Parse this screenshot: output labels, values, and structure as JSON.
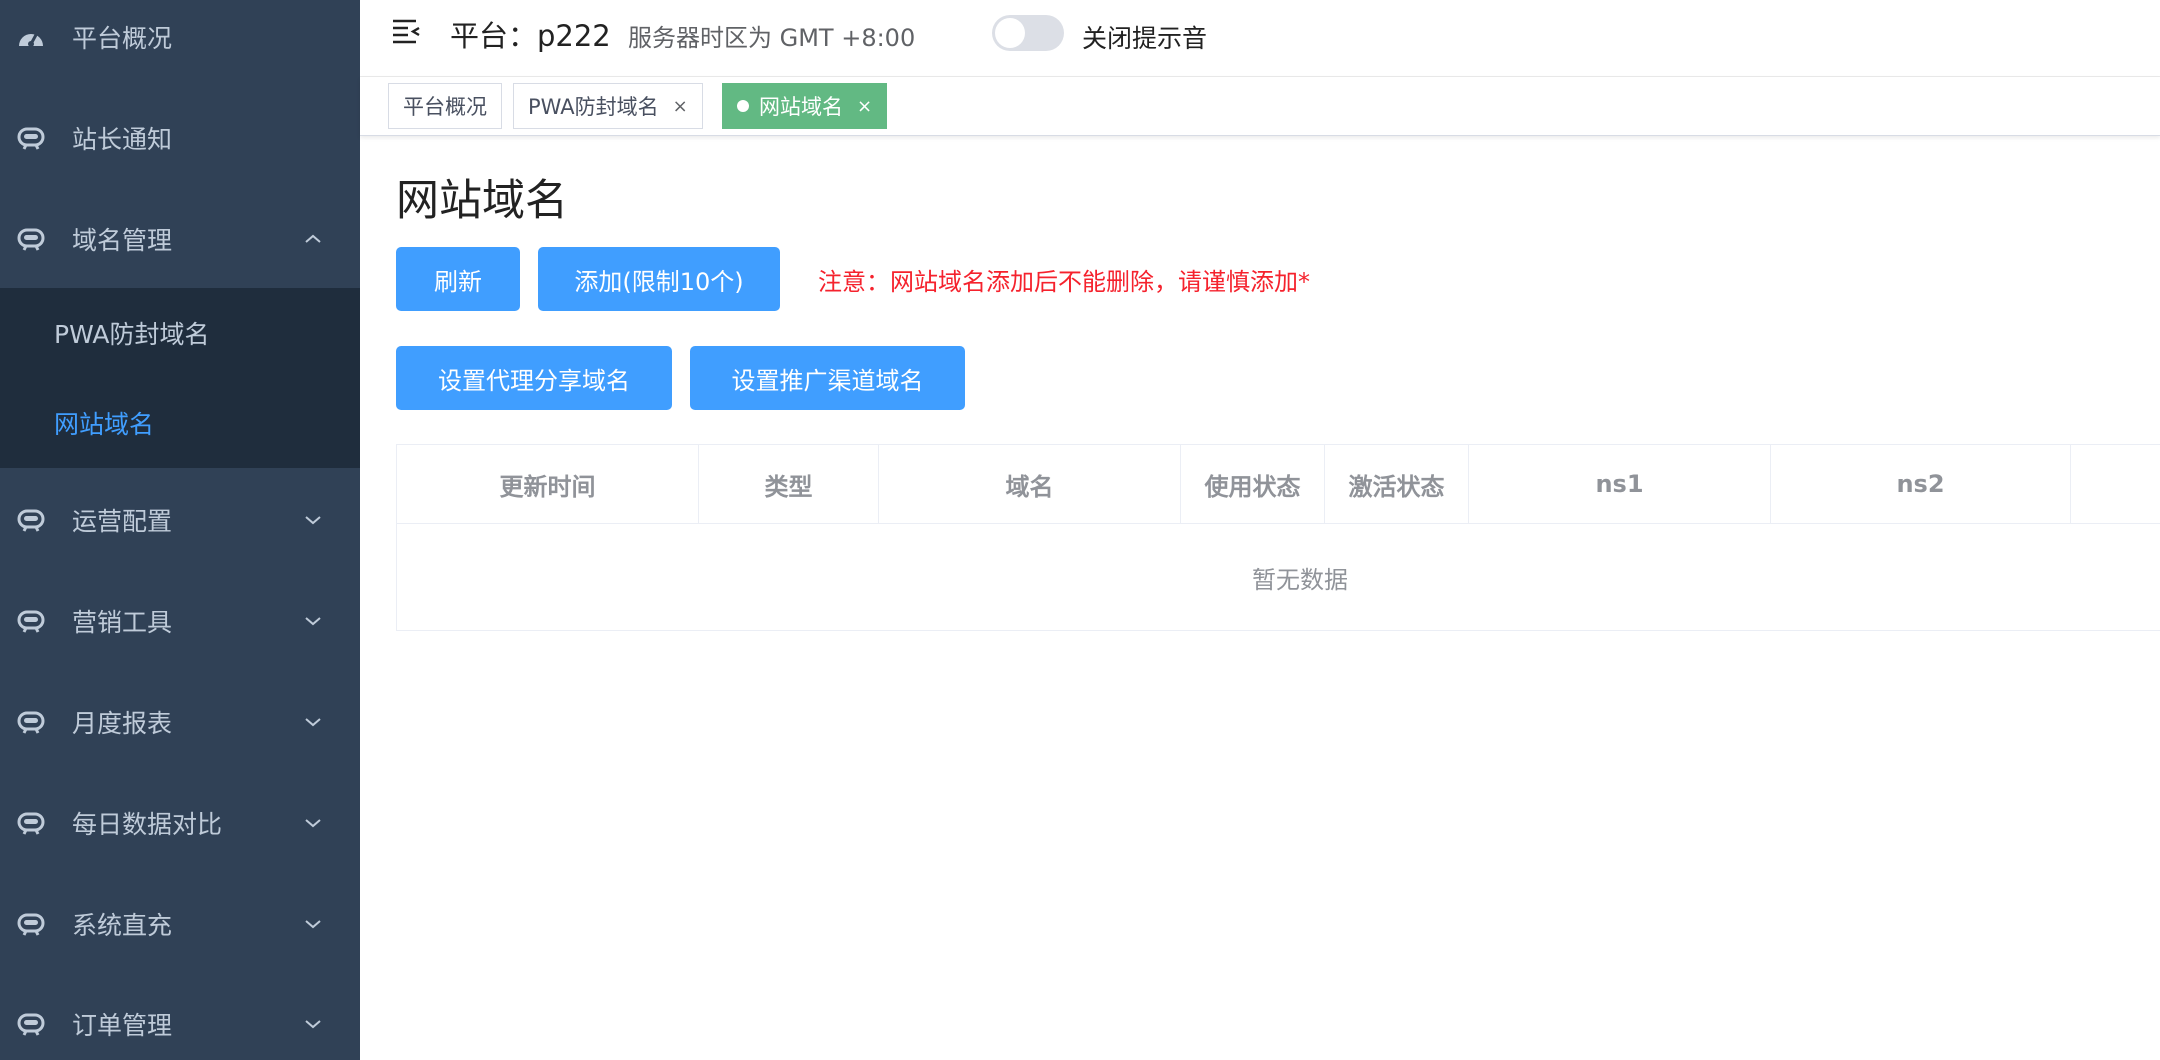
{
  "sidebar": {
    "items": [
      {
        "label": "平台概况",
        "icon": "dashboard-icon",
        "expandable": false
      },
      {
        "label": "站长通知",
        "icon": "menu-icon",
        "expandable": false
      },
      {
        "label": "域名管理",
        "icon": "menu-icon",
        "expandable": true,
        "expanded": true
      },
      {
        "label": "运营配置",
        "icon": "menu-icon",
        "expandable": true
      },
      {
        "label": "营销工具",
        "icon": "menu-icon",
        "expandable": true
      },
      {
        "label": "月度报表",
        "icon": "menu-icon",
        "expandable": true
      },
      {
        "label": "每日数据对比",
        "icon": "menu-icon",
        "expandable": true
      },
      {
        "label": "系统直充",
        "icon": "menu-icon",
        "expandable": true
      },
      {
        "label": "订单管理",
        "icon": "menu-icon",
        "expandable": true
      }
    ],
    "submenu": [
      {
        "label": "PWA防封域名",
        "active": false
      },
      {
        "label": "网站域名",
        "active": true
      }
    ],
    "colors": {
      "bg": "#304156",
      "submenu_bg": "#1f2d3d",
      "text": "#bfcbd9",
      "active": "#409eff"
    }
  },
  "navbar": {
    "platform": "平台：p222",
    "timezone": "服务器时区为 GMT +8:00",
    "sound_toggle_label": "关闭提示音",
    "sound_toggle_on": false
  },
  "tags": [
    {
      "label": "平台概况",
      "closable": false,
      "active": false
    },
    {
      "label": "PWA防封域名",
      "closable": true,
      "active": false
    },
    {
      "label": "网站域名",
      "closable": true,
      "active": true
    }
  ],
  "tag_close_glyph": "×",
  "main": {
    "title": "网站域名",
    "refresh_label": "刷新",
    "add_label": "添加(限制10个)",
    "warning": "注意：网站域名添加后不能删除，请谨慎添加*",
    "proxy_share_label": "设置代理分享域名",
    "promo_channel_label": "设置推广渠道域名"
  },
  "table": {
    "columns": [
      "更新时间",
      "类型",
      "域名",
      "使用状态",
      "激活状态",
      "ns1",
      "ns2"
    ],
    "rows": [],
    "empty_text": "暂无数据"
  },
  "colors": {
    "primary": "#409eff",
    "danger": "#f5222d",
    "tag_active": "#62b983"
  }
}
